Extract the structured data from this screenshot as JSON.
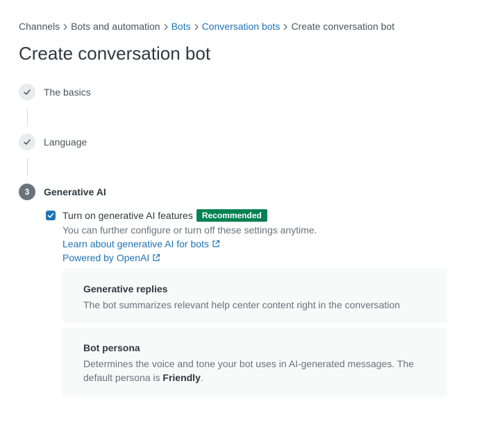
{
  "breadcrumb": [
    {
      "label": "Channels",
      "link": false
    },
    {
      "label": "Bots and automation",
      "link": false
    },
    {
      "label": "Bots",
      "link": true
    },
    {
      "label": "Conversation bots",
      "link": true
    },
    {
      "label": "Create conversation bot",
      "link": false
    }
  ],
  "page_title": "Create conversation bot",
  "steps": [
    {
      "label": "The basics",
      "status": "complete"
    },
    {
      "label": "Language",
      "status": "complete"
    },
    {
      "label": "Generative AI",
      "status": "active",
      "number": "3"
    }
  ],
  "generative_ai": {
    "checkbox_label": "Turn on generative AI features",
    "checked": true,
    "badge": "Recommended",
    "hint": "You can further configure or turn off these settings anytime.",
    "learn_link": "Learn about generative AI for bots",
    "powered_link": "Powered by OpenAI"
  },
  "cards": {
    "replies": {
      "title": "Generative replies",
      "description": "The bot summarizes relevant help center content right in the conversation"
    },
    "persona": {
      "title": "Bot persona",
      "description_prefix": "Determines the voice and tone your bot uses in AI-generated messages. The default persona is ",
      "description_strong": "Friendly",
      "description_suffix": "."
    }
  },
  "colors": {
    "link": "#1f73b7",
    "badge": "#038153",
    "checkbox": "#1f73b7"
  },
  "icons": {
    "step_complete": "check-icon",
    "external_link": "external-link-icon",
    "separator": "chevron-right-icon"
  }
}
